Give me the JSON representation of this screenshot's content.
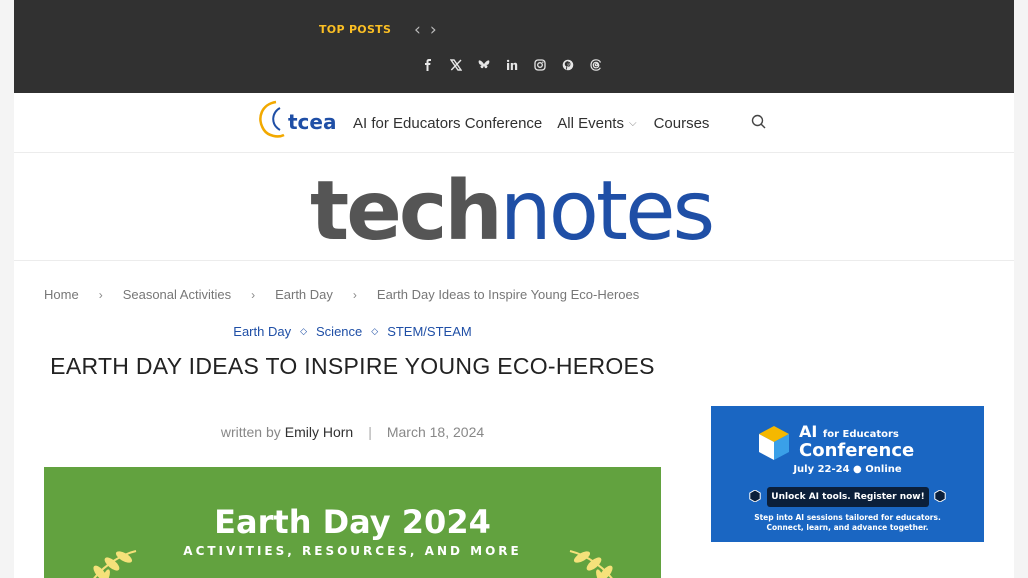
{
  "topbar": {
    "top_posts_label": "TOP POSTS",
    "prev_arrow": "‹",
    "next_arrow": "›",
    "socials": [
      "facebook-icon",
      "x-icon",
      "bluesky-icon",
      "linkedin-icon",
      "instagram-icon",
      "pinterest-icon",
      "threads-icon"
    ],
    "background": "#313131",
    "accent": "#fbbf24"
  },
  "nav": {
    "logo_text": "tcea",
    "items": [
      {
        "label": "AI for Educators Conference"
      },
      {
        "label": "All Events"
      },
      {
        "label": "Courses"
      }
    ],
    "search_icon": "search-icon"
  },
  "masthead": {
    "part1": "tech",
    "part2": "notes",
    "color1": "#555555",
    "color2": "#1f4fa6"
  },
  "breadcrumbs": [
    "Home",
    "Seasonal Activities",
    "Earth Day",
    "Earth Day Ideas to Inspire Young Eco-Heroes"
  ],
  "article": {
    "categories": [
      "Earth Day",
      "Science",
      "STEM/STEAM"
    ],
    "title": "EARTH DAY IDEAS TO INSPIRE YOUNG ECO-HEROES",
    "written_by": "written by",
    "author": "Emily Horn",
    "date": "March 18, 2024",
    "hero": {
      "title": "Earth Day 2024",
      "subtitle": "ACTIVITIES, RESOURCES, AND MORE",
      "background": "#62a23f"
    }
  },
  "sidebar_ad": {
    "title_line1_a": "AI",
    "title_line1_b": "for Educators",
    "title_line2": "Conference",
    "date_line": "July 22-24  ●  Online",
    "button": "Unlock AI tools. Register now!",
    "footer_line1": "Step into AI sessions tailored for educators.",
    "footer_line2": "Connect, learn, and advance together.",
    "background": "#1a66c2"
  }
}
